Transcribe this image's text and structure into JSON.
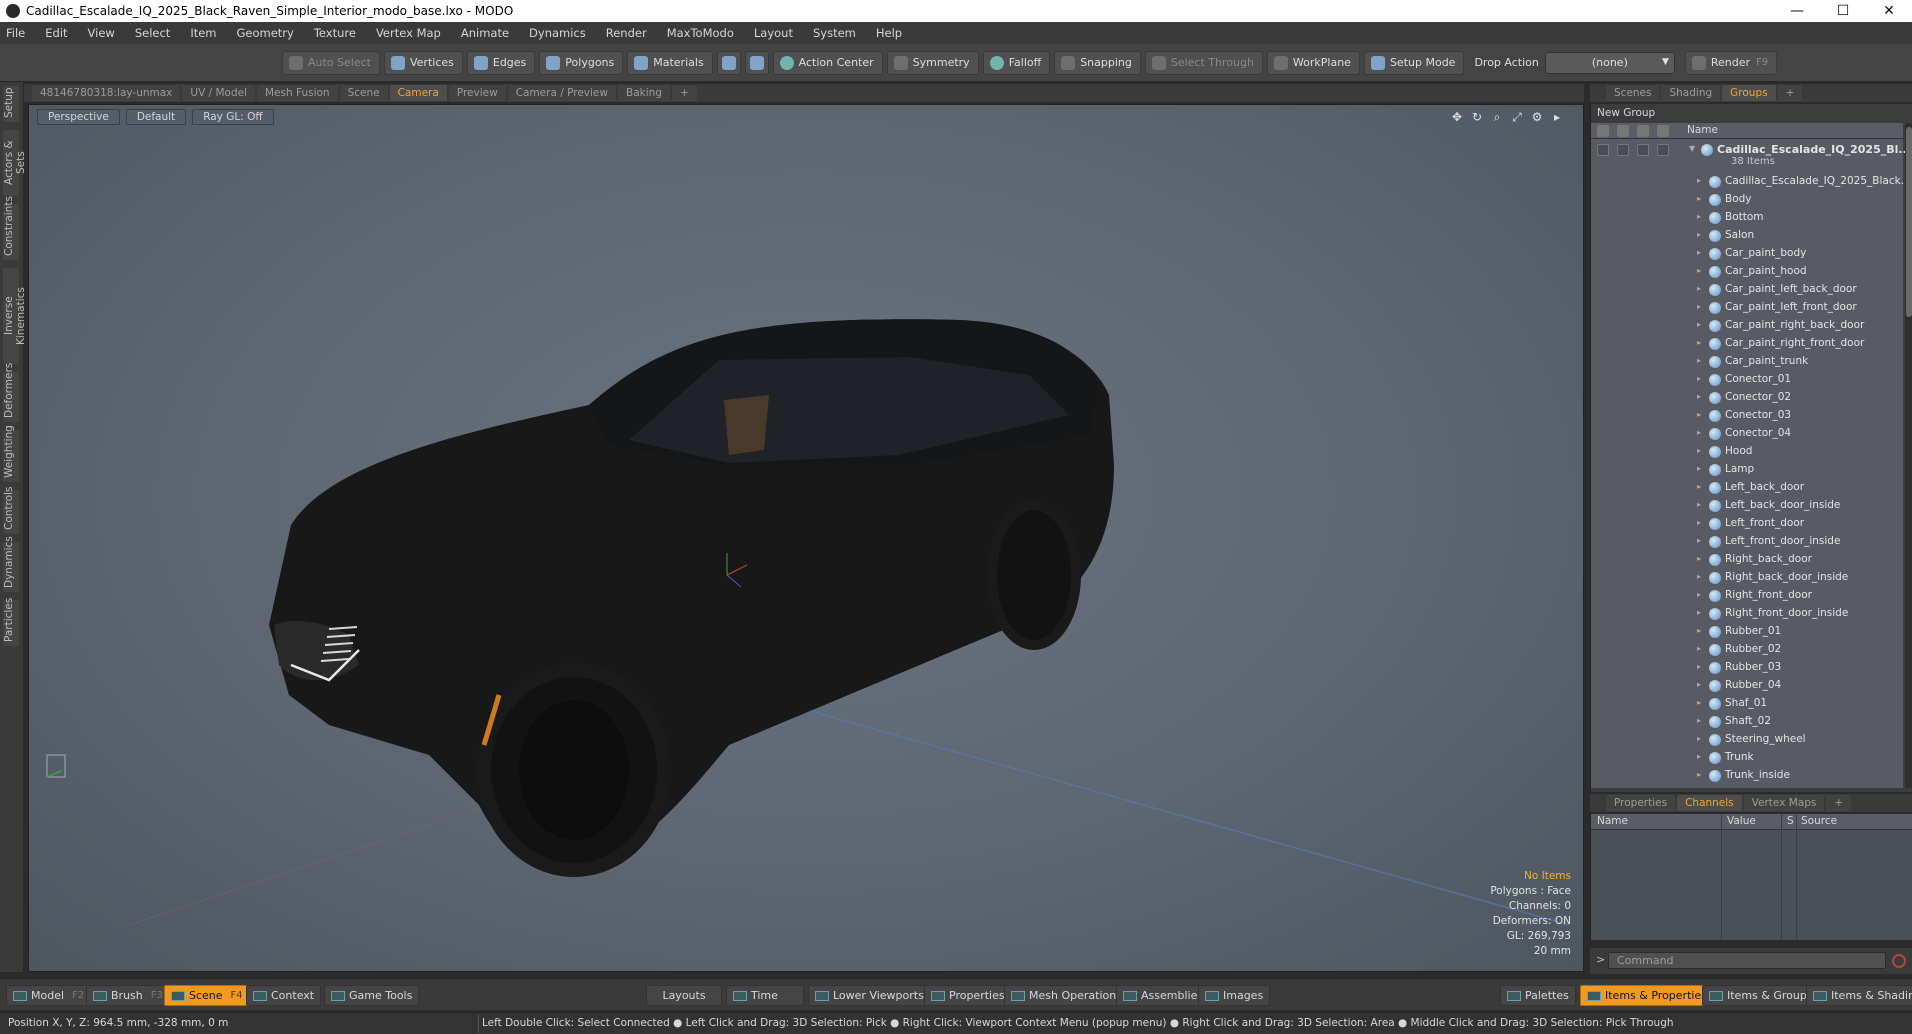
{
  "window": {
    "title": "Cadillac_Escalade_IQ_2025_Black_Raven_Simple_Interior_modo_base.lxo - MODO",
    "minimize": "—",
    "maximize": "☐",
    "close": "✕"
  },
  "menu": [
    "File",
    "Edit",
    "View",
    "Select",
    "Item",
    "Geometry",
    "Texture",
    "Vertex Map",
    "Animate",
    "Dynamics",
    "Render",
    "MaxToModo",
    "Layout",
    "System",
    "Help"
  ],
  "toolbar": {
    "auto_select": "Auto Select",
    "vertices": "Vertices",
    "edges": "Edges",
    "polygons": "Polygons",
    "materials": "Materials",
    "action_center": "Action Center",
    "symmetry": "Symmetry",
    "falloff": "Falloff",
    "snapping": "Snapping",
    "select_through": "Select Through",
    "workplane": "WorkPlane",
    "setup_mode": "Setup Mode",
    "drop_action": "Drop Action",
    "drop_value": "(none)",
    "render": "Render",
    "render_key": "F9"
  },
  "left_tabs": [
    "Setup",
    "Actors & Sets",
    "Constraints",
    "Inverse Kinematics",
    "Deformers",
    "Weighting",
    "Controls",
    "Dynamics",
    "Particles"
  ],
  "viewport_tabs": [
    "48146780318:lay-unmax",
    "UV / Model",
    "Mesh Fusion",
    "Scene",
    "Camera",
    "Preview",
    "Camera / Preview",
    "Baking",
    "+"
  ],
  "viewport": {
    "perspective": "Perspective",
    "default": "Default",
    "raygl": "Ray GL: Off",
    "info": {
      "no_items": "No Items",
      "polygons": "Polygons : Face",
      "channels": "Channels: 0",
      "deformers": "Deformers: ON",
      "gl": "GL: 269,793",
      "scale": "20 mm"
    }
  },
  "right_tabs": [
    "Scenes",
    "Shading",
    "Groups",
    "+"
  ],
  "groups": {
    "new_group": "New Group",
    "name_header": "Name",
    "root": "Cadillac_Escalade_IQ_2025_Bl...",
    "root_count": "38 Items",
    "items": [
      "Cadillac_Escalade_IQ_2025_Black...",
      "Body",
      "Bottom",
      "Salon",
      "Car_paint_body",
      "Car_paint_hood",
      "Car_paint_left_back_door",
      "Car_paint_left_front_door",
      "Car_paint_right_back_door",
      "Car_paint_right_front_door",
      "Car_paint_trunk",
      "Conector_01",
      "Conector_02",
      "Conector_03",
      "Conector_04",
      "Hood",
      "Lamp",
      "Left_back_door",
      "Left_back_door_inside",
      "Left_front_door",
      "Left_front_door_inside",
      "Right_back_door",
      "Right_back_door_inside",
      "Right_front_door",
      "Right_front_door_inside",
      "Rubber_01",
      "Rubber_02",
      "Rubber_03",
      "Rubber_04",
      "Shaf_01",
      "Shaft_02",
      "Steering_wheel",
      "Trunk",
      "Trunk_inside"
    ]
  },
  "channel_tabs": [
    "Properties",
    "Channels",
    "Vertex Maps",
    "+"
  ],
  "channels": {
    "name": "Name",
    "value": "Value",
    "s": "S",
    "source": "Source"
  },
  "command_placeholder": "Command",
  "bottom": {
    "model": "Model",
    "model_key": "F2",
    "brush": "Brush",
    "brush_key": "F3",
    "scene": "Scene",
    "scene_key": "F4",
    "context": "Context",
    "game_tools": "Game Tools",
    "layouts": "Layouts",
    "time": "Time",
    "lower_viewports": "Lower Viewports",
    "properties": "Properties",
    "mesh_operations": "Mesh Operations",
    "assemblies": "Assemblies",
    "images": "Images",
    "palettes": "Palettes",
    "items_properties": "Items & Properties",
    "items_groups": "Items & Groups",
    "items_shading": "Items & Shading"
  },
  "status": {
    "position": "Position X, Y, Z:   964.5 mm, -328 mm, 0 m",
    "hint": "Left Double Click: Select Connected ● Left Click and Drag: 3D Selection: Pick ● Right Click: Viewport Context Menu (popup menu) ● Right Click and Drag: 3D Selection: Area ● Middle Click and Drag: 3D Selection: Pick Through"
  },
  "colors": {
    "accent": "#f0a531",
    "active_bg": "#f09a22",
    "viewport": "#5d6671"
  }
}
